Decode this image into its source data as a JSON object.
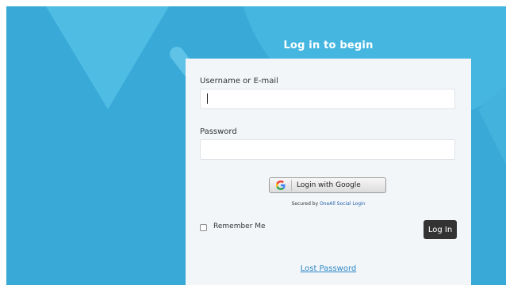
{
  "page": {
    "title": "Log in to begin"
  },
  "form": {
    "username_label": "Username or E-mail",
    "username_value": "",
    "password_label": "Password",
    "password_value": "",
    "google_button_label": "Login with Google",
    "google_icon": "google-g-icon",
    "secured_prefix": "Secured by ",
    "secured_link": "OneAll Social Login",
    "remember_label": "Remember Me",
    "remember_checked": false,
    "login_button_label": "Log In",
    "lost_password_label": "Lost Password"
  },
  "colors": {
    "background": "#39a9d8",
    "card": "#f3f6f9",
    "button_dark": "#333333",
    "link": "#2f89c5"
  }
}
